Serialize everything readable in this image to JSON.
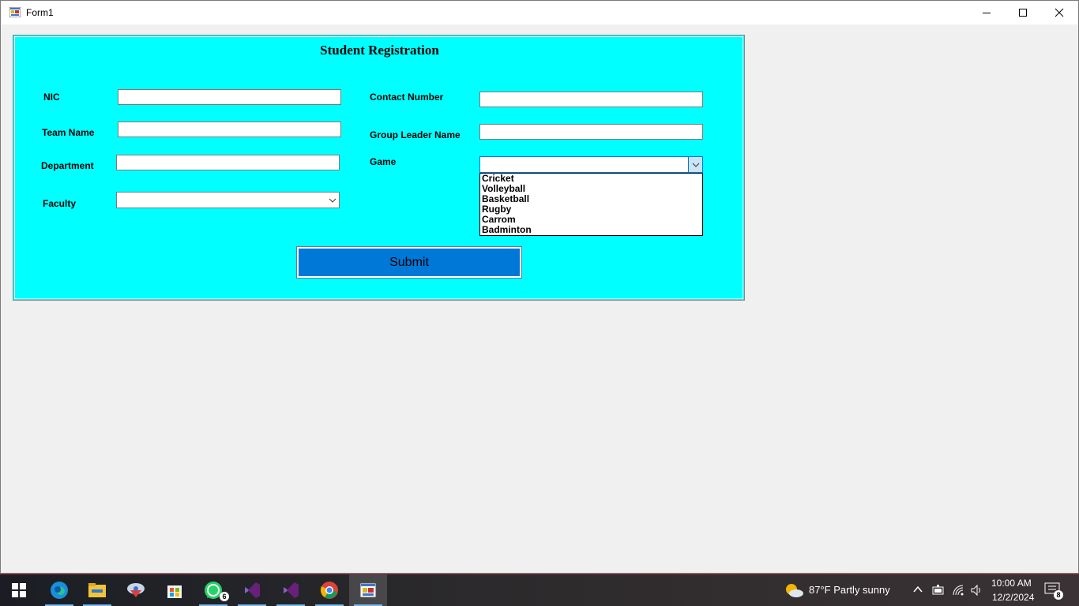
{
  "window": {
    "title": "Form1",
    "minimize_label": "—",
    "maximize_label": "☐",
    "close_label": "✕"
  },
  "form": {
    "heading": "Student Registration",
    "labels": {
      "nic": "NIC",
      "team_name": "Team Name",
      "department": "Department",
      "faculty": "Faculty",
      "contact_number": "Contact Number",
      "group_leader_name": "Group Leader Name",
      "game": "Game"
    },
    "values": {
      "nic": "",
      "team_name": "",
      "department": "",
      "faculty": "",
      "contact_number": "",
      "group_leader_name": "",
      "game": ""
    },
    "game_options": [
      "Cricket",
      "Volleyball",
      "Basketball",
      "Rugby",
      "Carrom",
      "Badminton"
    ],
    "submit_label": "Submit"
  },
  "taskbar": {
    "weather": "87°F  Partly sunny",
    "time": "10:00 AM",
    "date": "12/2/2024",
    "whatsapp_badge": "6",
    "notification_badge": "8",
    "apps": [
      "start-icon",
      "edge-icon",
      "file-explorer-icon",
      "app-icon",
      "store-icon",
      "whatsapp-icon",
      "visual-studio-icon",
      "visual-studio-icon",
      "chrome-icon",
      "form-app-icon"
    ]
  },
  "colors": {
    "panel_bg": "#00ffff",
    "button_bg": "#0078d7",
    "window_bg": "#f0f0f0"
  }
}
